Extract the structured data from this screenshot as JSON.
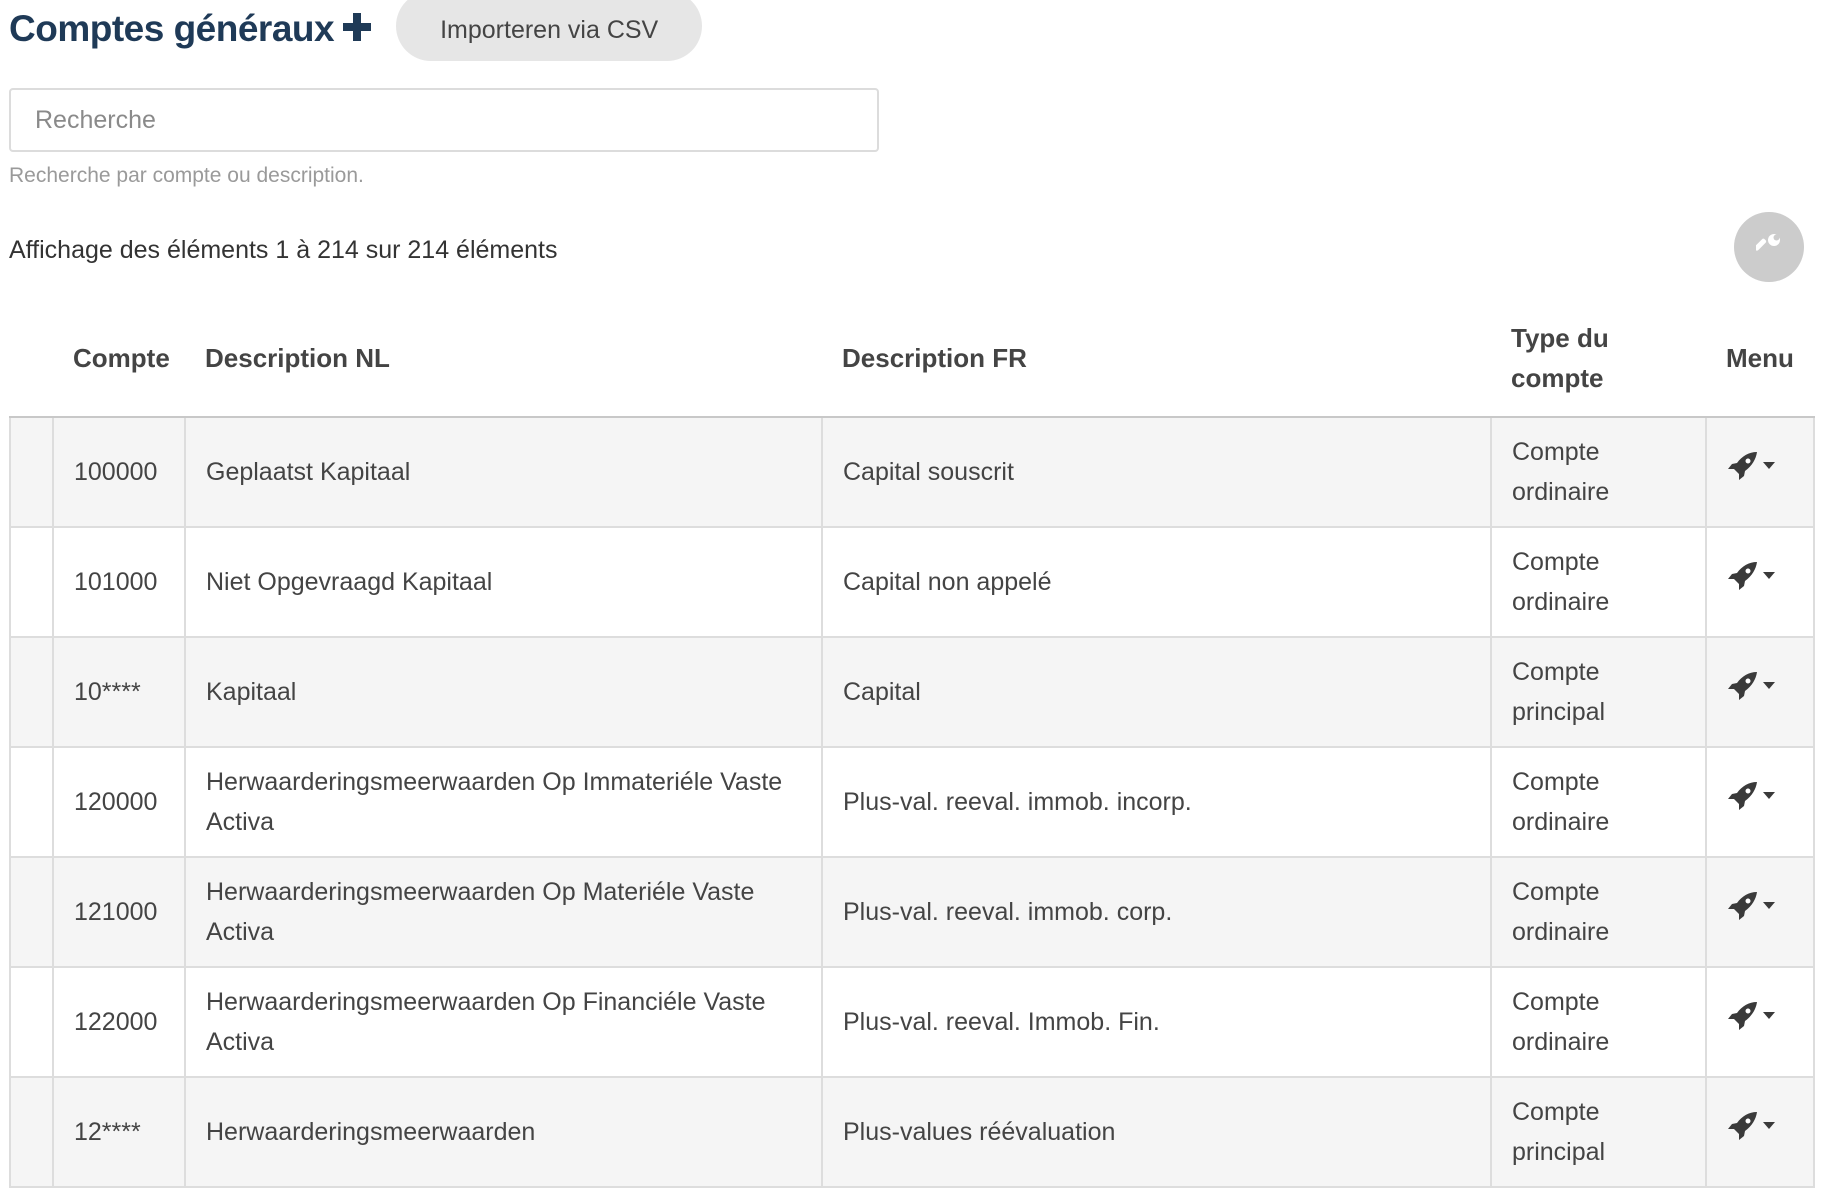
{
  "header": {
    "title": "Comptes généraux",
    "add_icon": "plus-icon",
    "import_button": "Importeren via CSV"
  },
  "search": {
    "placeholder": "Recherche",
    "value": "",
    "help": "Recherche par compte ou description."
  },
  "summary": "Affichage des éléments 1 à 214 sur 214 éléments",
  "settings_icon": "wrench-icon",
  "table": {
    "columns": {
      "account": "Compte",
      "desc_nl": "Description NL",
      "desc_fr": "Description FR",
      "type": "Type du compte",
      "menu": "Menu"
    },
    "rows": [
      {
        "account": "100000",
        "desc_nl": "Geplaatst Kapitaal",
        "desc_fr": "Capital souscrit",
        "type": "Compte ordinaire"
      },
      {
        "account": "101000",
        "desc_nl": "Niet Opgevraagd Kapitaal",
        "desc_fr": "Capital non appelé",
        "type": "Compte ordinaire"
      },
      {
        "account": "10****",
        "desc_nl": "Kapitaal",
        "desc_fr": "Capital",
        "type": "Compte principal"
      },
      {
        "account": "120000",
        "desc_nl": "Herwaarderingsmeerwaarden Op Immateriéle Vaste Activa",
        "desc_fr": "Plus-val. reeval. immob. incorp.",
        "type": "Compte ordinaire"
      },
      {
        "account": "121000",
        "desc_nl": "Herwaarderingsmeerwaarden Op Materiéle Vaste Activa",
        "desc_fr": "Plus-val. reeval. immob. corp.",
        "type": "Compte ordinaire"
      },
      {
        "account": "122000",
        "desc_nl": "Herwaarderingsmeerwaarden Op Financiéle Vaste Activa",
        "desc_fr": "Plus-val. reeval. Immob. Fin.",
        "type": "Compte ordinaire"
      },
      {
        "account": "12****",
        "desc_nl": "Herwaarderingsmeerwaarden",
        "desc_fr": "Plus-values réévaluation",
        "type": "Compte principal"
      }
    ],
    "row_menu_icon": "rocket-icon"
  },
  "colors": {
    "title": "#1f3a57",
    "button_bg": "#e6e6e6",
    "row_alt": "#f5f5f5"
  }
}
